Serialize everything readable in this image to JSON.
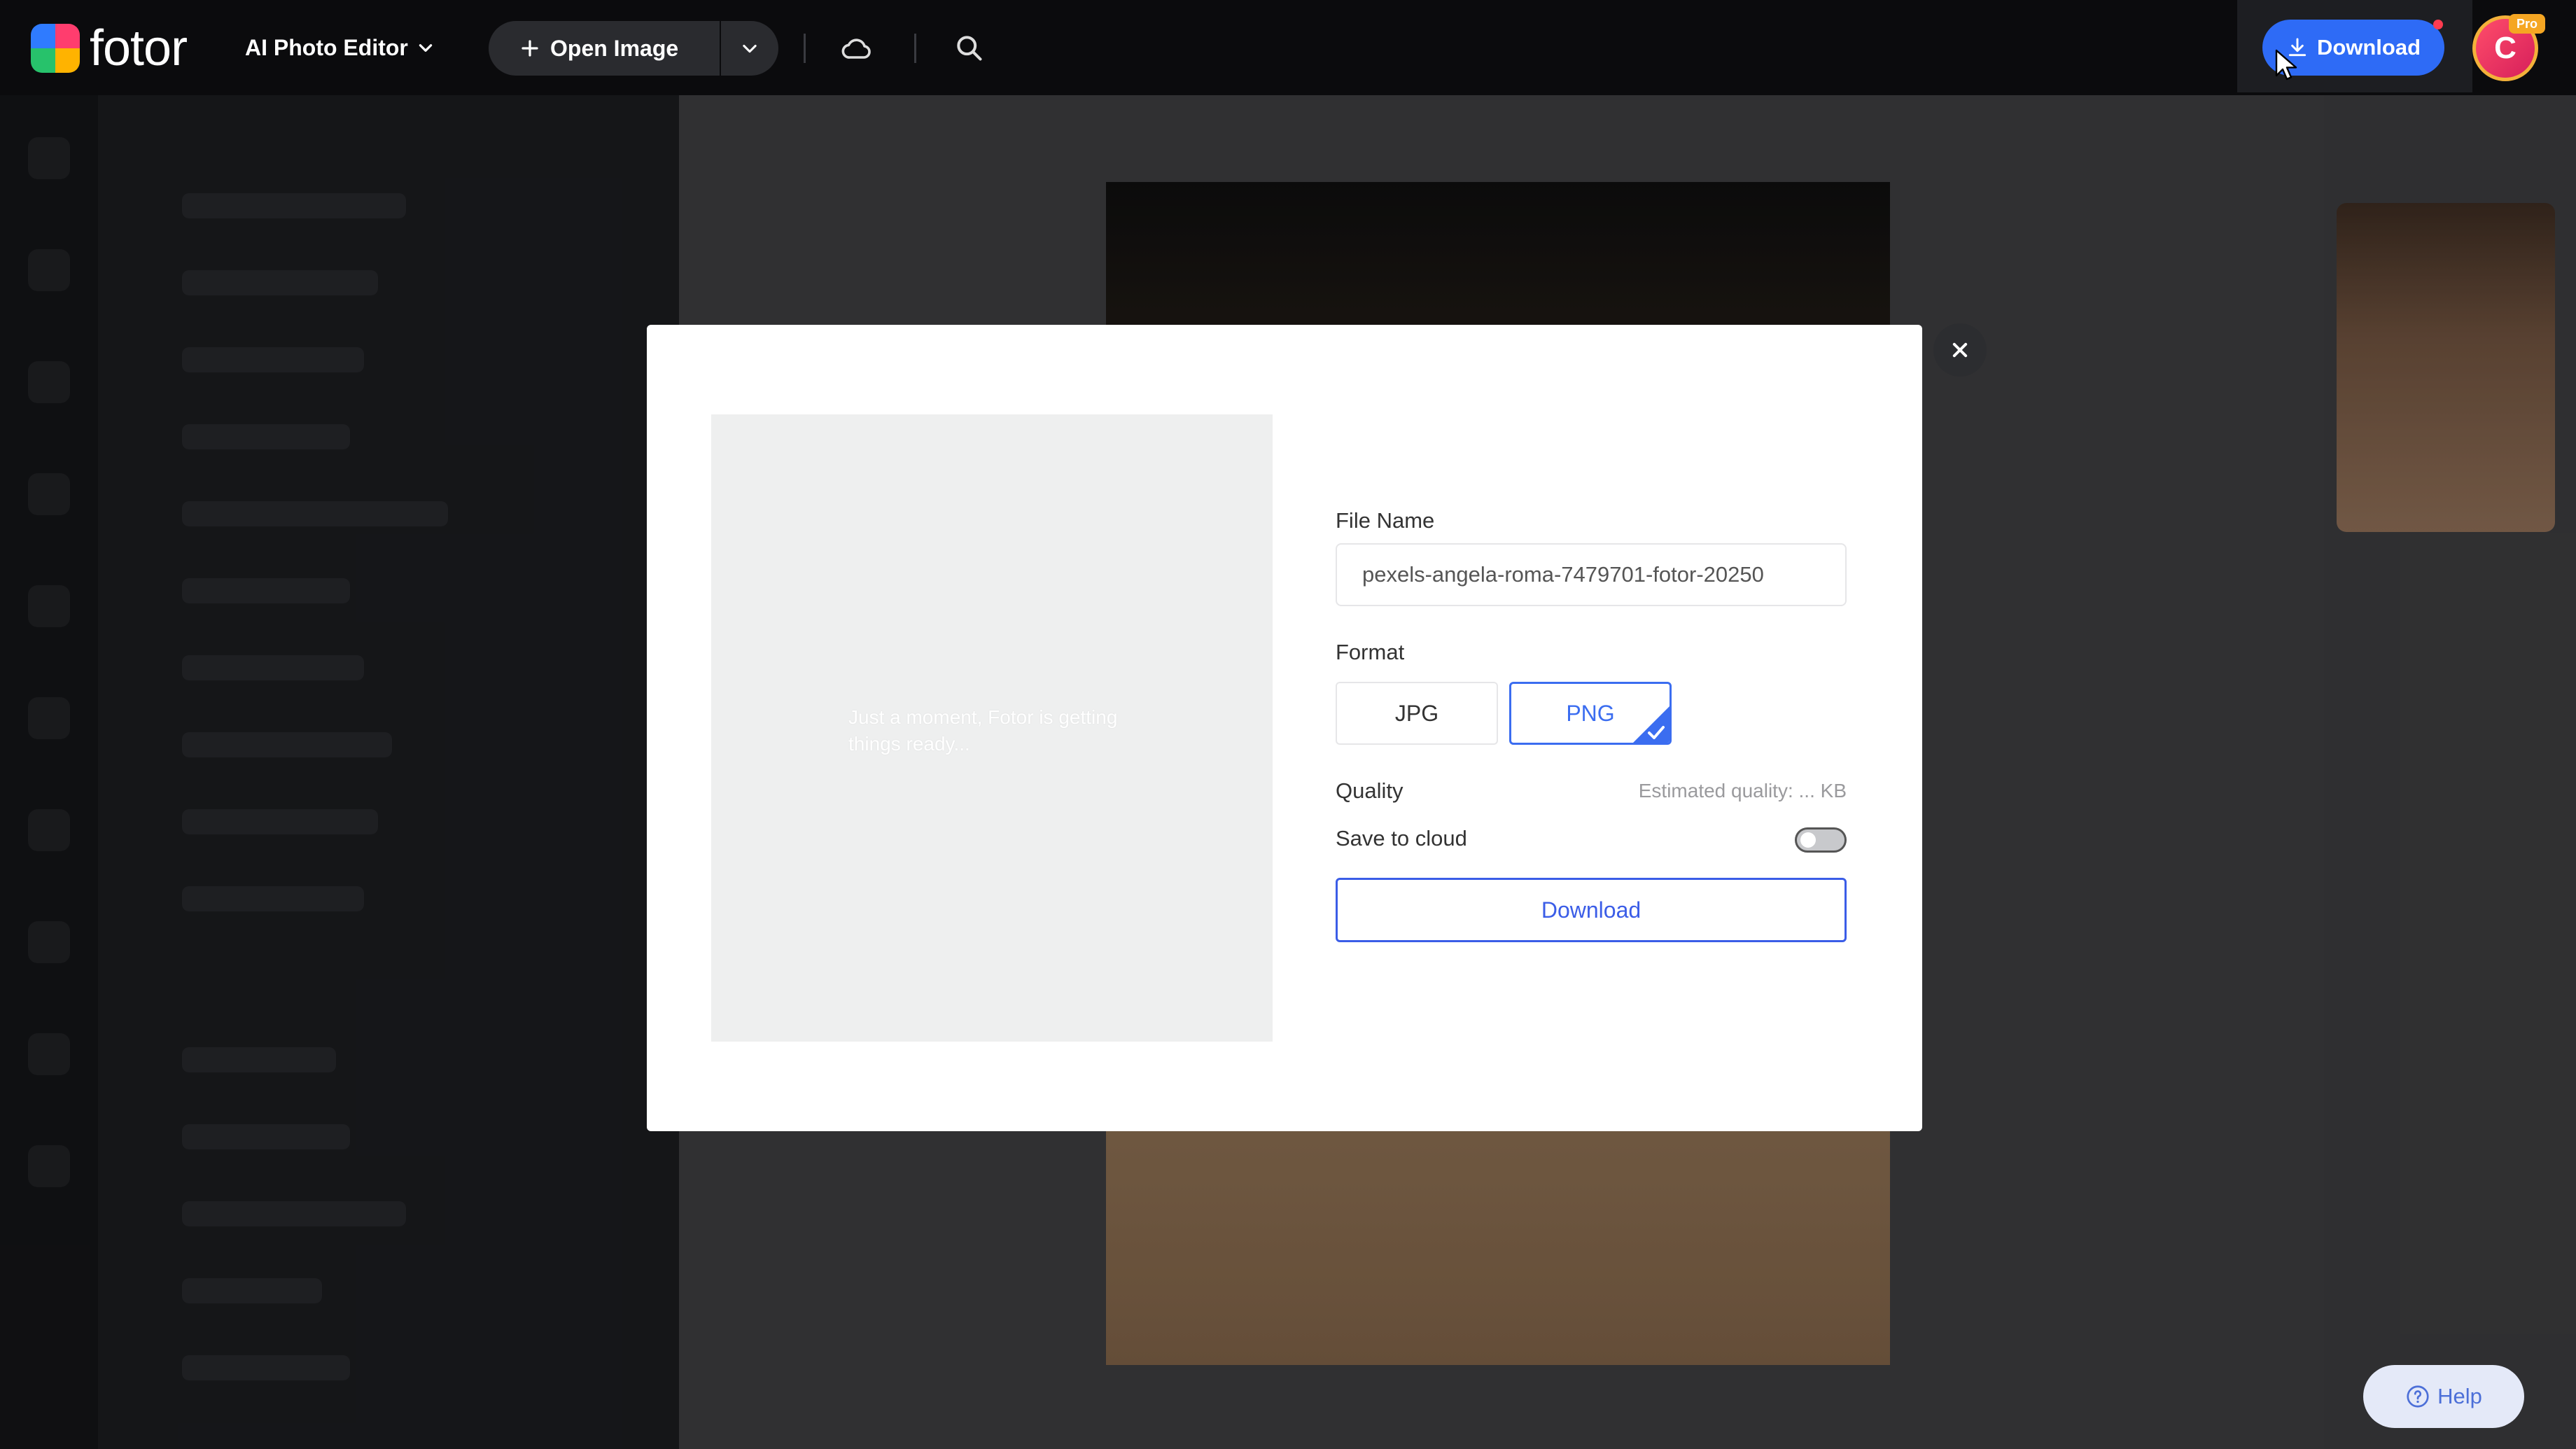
{
  "topbar": {
    "logo_text": "fotor",
    "editor_menu_label": "AI Photo Editor",
    "open_image_label": "Open Image",
    "download_label": "Download",
    "avatar_initial": "C",
    "pro_badge": "Pro"
  },
  "preview": {
    "loading_message": "Just a moment, Fotor is getting things ready..."
  },
  "download_dialog": {
    "file_name_label": "File Name",
    "file_name_value": "pexels-angela-roma-7479701-fotor-20250",
    "format_label": "Format",
    "formats": [
      {
        "label": "JPG",
        "selected": false
      },
      {
        "label": "PNG",
        "selected": true
      }
    ],
    "quality_label": "Quality",
    "estimated_quality": "Estimated quality: ... KB",
    "save_to_cloud_label": "Save to cloud",
    "save_to_cloud_on": false,
    "download_button": "Download"
  },
  "help": {
    "label": "Help"
  },
  "colors": {
    "accent": "#3b6df0",
    "topbar_download": "#2e6bf6",
    "overlay": "#3b3b3d"
  }
}
